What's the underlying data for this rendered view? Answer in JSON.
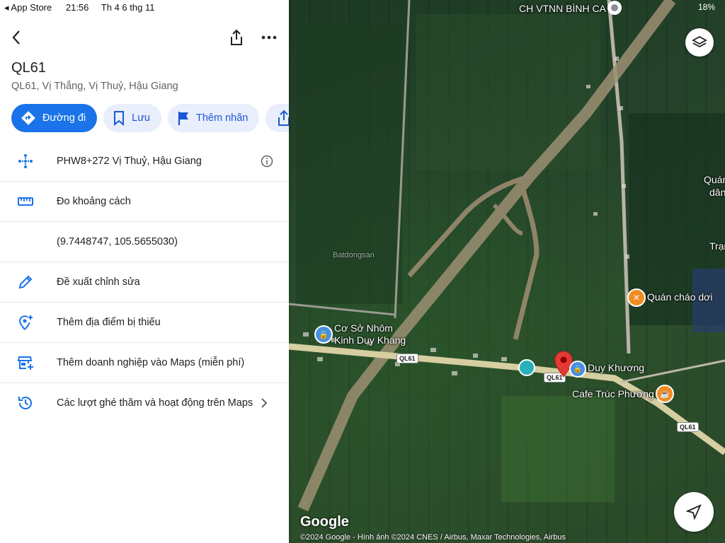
{
  "status": {
    "back_app": "◂ App Store",
    "time": "21:56",
    "date": "Th 4 6 thg 11",
    "battery": "18%"
  },
  "place": {
    "title": "QL61",
    "subtitle": "QL61, Vị Thắng, Vị Thuỷ, Hậu Giang"
  },
  "chips": {
    "directions": "Đường đi",
    "save": "Lưu",
    "label": "Thêm nhãn"
  },
  "rows": {
    "plus_code": "PHW8+272 Vị Thuỷ, Hậu Giang",
    "measure": "Đo khoảng cách",
    "coords": "(9.7448747, 105.5655030)",
    "suggest_edit": "Đề xuất chỉnh sửa",
    "add_missing": "Thêm địa điểm bị thiếu",
    "add_business": "Thêm doanh nghiệp vào Maps (miễn phí)",
    "activity": "Các lượt ghé thăm và hoạt động trên Maps"
  },
  "map": {
    "top_label": "CH VTNN BÌNH CA",
    "poi_1": "Cơ Sở Nhôm\nKinh Duy Khang",
    "poi_2": "Duy Khương",
    "poi_3": "Cafe Trúc Phương",
    "poi_4": "Quán cháo dơi",
    "edge_1": "Quán",
    "edge_2": "dân",
    "edge_3": "Trạm",
    "road_tag": "QL61",
    "watermark": "Batdongsan",
    "google": "Google",
    "attribution": "©2024 Google - Hình ảnh ©2024 CNES / Airbus, Maxar Technologies, Airbus"
  }
}
